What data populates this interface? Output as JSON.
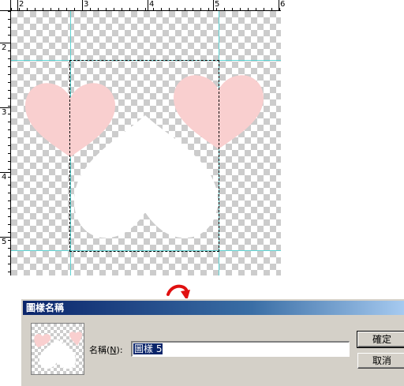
{
  "ruler": {
    "top_numbers": [
      "2",
      "3",
      "4",
      "5",
      "6"
    ],
    "left_numbers": [
      "2",
      "3",
      "4",
      "5"
    ]
  },
  "colors": {
    "guide": "#5fd3d3",
    "heart_pink": "#f9cfcf",
    "heart_white": "#ffffff",
    "arrow": "#e01010",
    "titlebar": "#0a246a",
    "selection": "#0a246a"
  },
  "dialog": {
    "title": "圖樣名稱",
    "name_label_main": "名稱(",
    "name_label_key": "N",
    "name_label_end": "):",
    "name_value": "圖樣 5",
    "ok_label": "確定",
    "cancel_label": "取消"
  }
}
